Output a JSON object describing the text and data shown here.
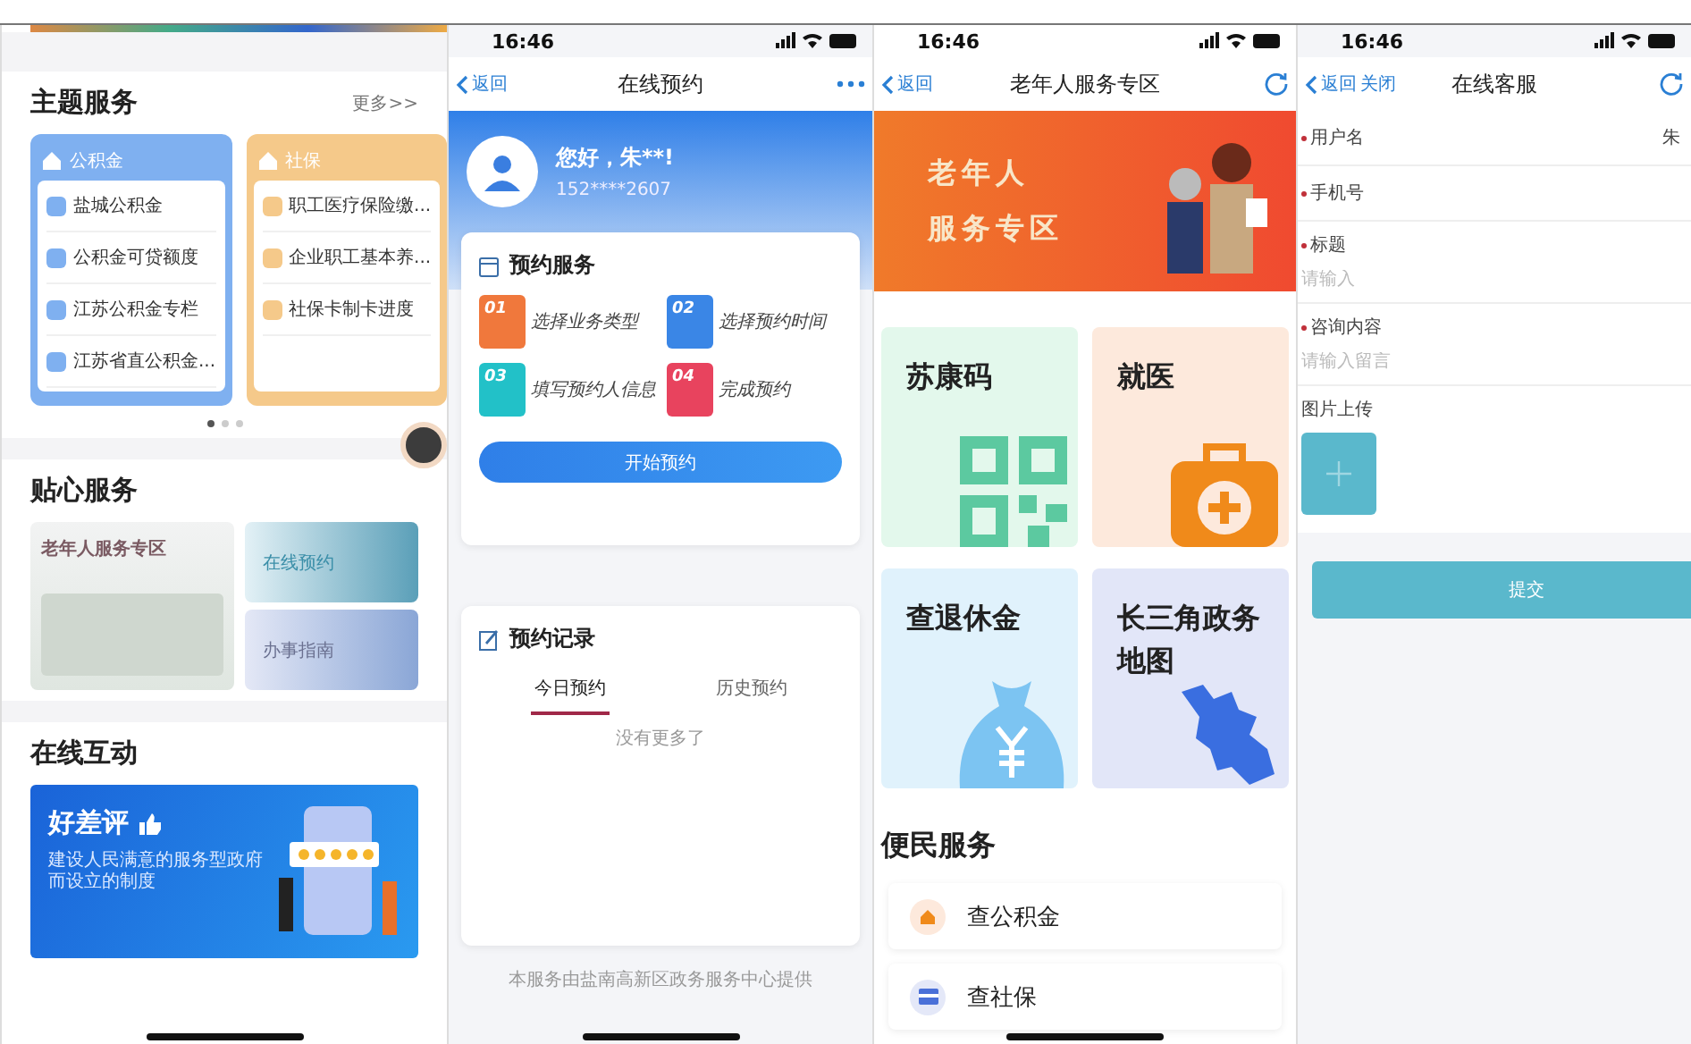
{
  "home": {
    "theme_services": {
      "title": "主题服务",
      "more": "更多>>",
      "cards": [
        {
          "title": "公积金",
          "color": "#7fb0f0",
          "items": [
            "盐城公积金",
            "公积金可贷额度",
            "江苏公积金专栏",
            "江苏省直公积金..."
          ]
        },
        {
          "title": "社保",
          "color": "#f5c98a",
          "items": [
            "职工医疗保险缴...",
            "企业职工基本养...",
            "社保卡制卡进度"
          ]
        }
      ],
      "carousel_dots": [
        {
          "selected": true
        },
        {
          "selected": false
        },
        {
          "selected": false
        }
      ]
    },
    "caring_services": {
      "title": "贴心服务",
      "feature": "老年人服务专区",
      "tiles": [
        "在线预约",
        "办事指南"
      ]
    },
    "interaction": {
      "title": "在线互动",
      "banner": {
        "title": "好差评",
        "text": "建设人民满意的服务型政府而设立的制度"
      }
    }
  },
  "booking": {
    "status_time": "16:46",
    "nav": {
      "back": "返回",
      "title": "在线预约"
    },
    "user": {
      "greeting": "您好，朱**!",
      "phone": "152****2607"
    },
    "service_card": {
      "title": "预约服务",
      "steps": [
        {
          "number": "01",
          "label": "选择业务类型",
          "color": "#f0783c"
        },
        {
          "number": "02",
          "label": "选择预约时间",
          "color": "#3a86e6"
        },
        {
          "number": "03",
          "label": "填写预约人信息",
          "color": "#22c1c8"
        },
        {
          "number": "04",
          "label": "完成预约",
          "color": "#e8435e"
        }
      ],
      "button": "开始预约"
    },
    "records_card": {
      "title": "预约记录",
      "tabs": [
        {
          "label": "今日预约",
          "selected": true
        },
        {
          "label": "历史预约",
          "selected": false
        }
      ],
      "empty": "没有更多了"
    },
    "footer": "本服务由盐南高新区政务服务中心提供"
  },
  "elderly": {
    "status_time": "16:46",
    "nav": {
      "back": "返回",
      "title": "老年人服务专区"
    },
    "banner_lines": [
      "老年人",
      "服务专区"
    ],
    "tiles": [
      {
        "label": "苏康码",
        "kind": "qr",
        "color": "#e3f8ec"
      },
      {
        "label": "就医",
        "kind": "medkit",
        "color": "#fde9dc"
      },
      {
        "label": "查退休金",
        "kind": "moneybag",
        "color": "#e0f2fc"
      },
      {
        "label": "长三角政务地图",
        "kind": "map",
        "color": "#e2e6f8"
      }
    ],
    "convenience": {
      "title": "便民服务",
      "items": [
        {
          "label": "查公积金",
          "kind": "house"
        },
        {
          "label": "查社保",
          "kind": "card"
        }
      ]
    }
  },
  "support": {
    "status_time": "16:46",
    "nav": {
      "back": "返回",
      "close": "关闭",
      "title": "在线客服"
    },
    "fields": [
      {
        "label": "用户名",
        "kind": "inline",
        "required": true,
        "value": "朱"
      },
      {
        "label": "手机号",
        "kind": "inline",
        "required": true
      },
      {
        "label": "标题",
        "kind": "stacked",
        "required": true,
        "placeholder": "请输入"
      },
      {
        "label": "咨询内容",
        "kind": "stacked",
        "required": true,
        "placeholder": "请输入留言"
      }
    ],
    "upload": {
      "label": "图片上传"
    },
    "submit": "提交"
  }
}
